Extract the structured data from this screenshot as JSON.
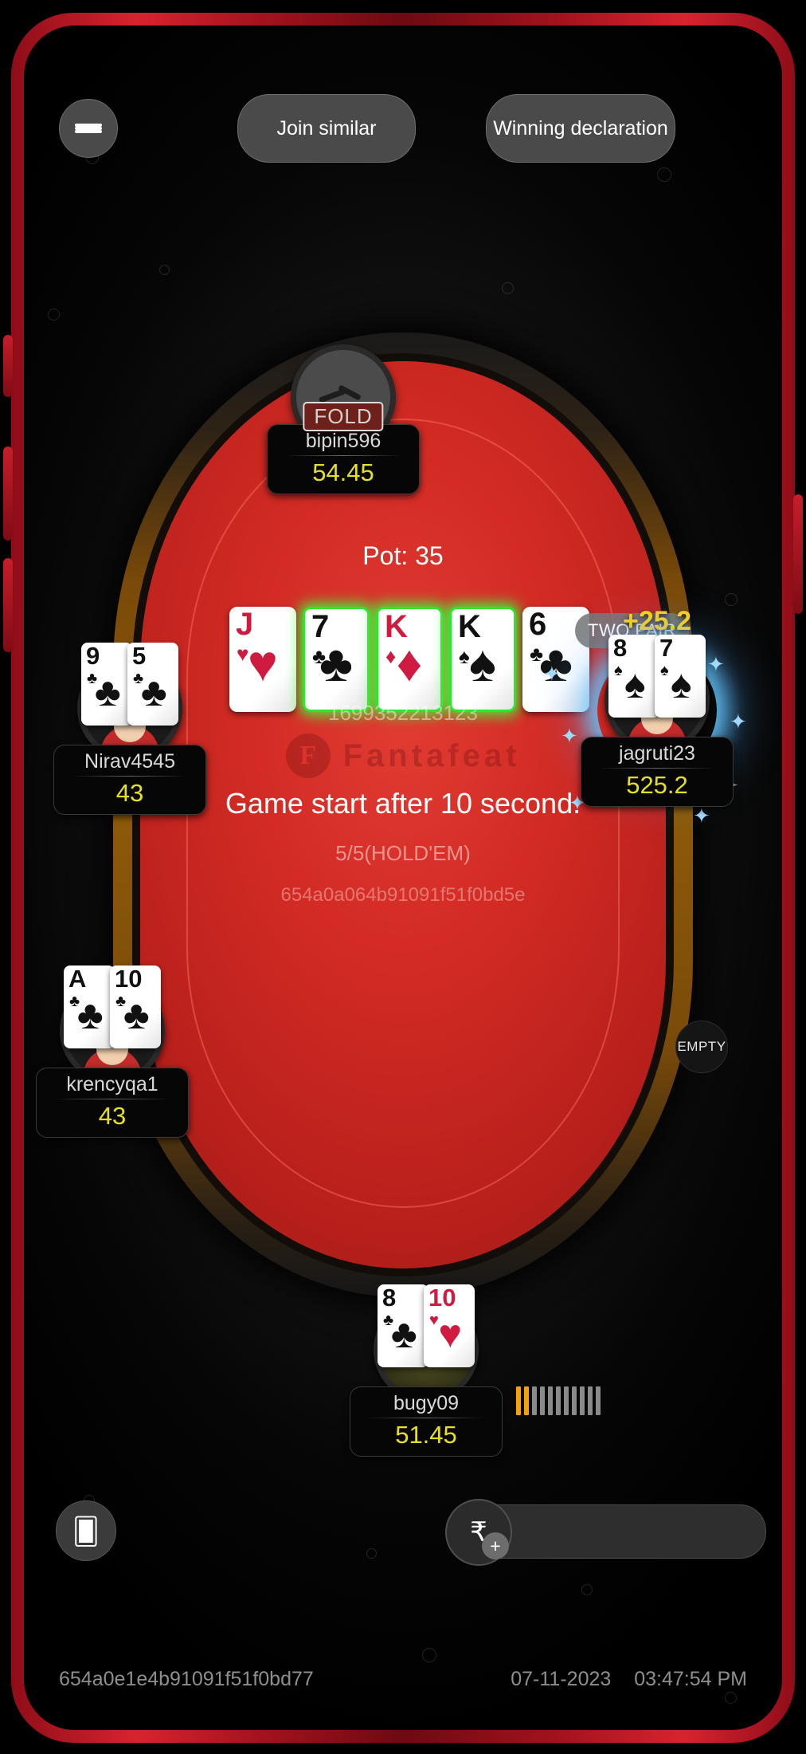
{
  "topbar": {
    "menu_icon": "hamburger-icon",
    "join_similar_label": "Join similar",
    "winning_declaration_label": "Winning declaration"
  },
  "table": {
    "pot_label": "Pot: 35",
    "hand_id": "1699352213123",
    "game_status": "Game start after 10 second.",
    "blinds": "5/5(HOLD'EM)",
    "table_id": "654a0a064b91091f51f0bd5e",
    "logo_word": "Fantafeat",
    "logo_mark": "F",
    "hand_rank_badge": "TWO PAIR",
    "empty_seat_label": "EMPTY"
  },
  "community_cards": [
    {
      "rank": "J",
      "suit": "♥",
      "color": "red",
      "highlight": false
    },
    {
      "rank": "7",
      "suit": "♣",
      "color": "black",
      "highlight": true
    },
    {
      "rank": "K",
      "suit": "♦",
      "color": "red",
      "highlight": true
    },
    {
      "rank": "K",
      "suit": "♠",
      "color": "black",
      "highlight": true
    },
    {
      "rank": "6",
      "suit": "♣",
      "color": "black",
      "highlight": false
    }
  ],
  "players": {
    "bipin596": {
      "name": "bipin596",
      "chips": "54.45",
      "status": "FOLD"
    },
    "nirav4545": {
      "name": "Nirav4545",
      "chips": "43",
      "cards": [
        {
          "rank": "9",
          "suit": "♣",
          "color": "black"
        },
        {
          "rank": "5",
          "suit": "♣",
          "color": "black"
        }
      ]
    },
    "jagruti23": {
      "name": "jagruti23",
      "chips": "525.2",
      "win_amount": "+25.2",
      "cards": [
        {
          "rank": "8",
          "suit": "♠",
          "color": "black"
        },
        {
          "rank": "7",
          "suit": "♠",
          "color": "black"
        }
      ]
    },
    "krencyqa1": {
      "name": "krencyqa1",
      "chips": "43",
      "cards": [
        {
          "rank": "A",
          "suit": "♣",
          "color": "black"
        },
        {
          "rank": "10",
          "suit": "♣",
          "color": "black"
        }
      ]
    },
    "bugy09": {
      "name": "bugy09",
      "chips": "51.45",
      "cards": [
        {
          "rank": "8",
          "suit": "♣",
          "color": "black"
        },
        {
          "rank": "10",
          "suit": "♥",
          "color": "red"
        }
      ],
      "timer_bars_total": 11,
      "timer_bars_active": 2
    }
  },
  "controls": {
    "cards_icon": "cards-icon",
    "chip_icon": "₹",
    "chip_plus": "+"
  },
  "footer": {
    "session_id": "654a0e1e4b91091f51f0bd77",
    "date": "07-11-2023",
    "time": "03:47:54 PM"
  },
  "colors": {
    "frame": "#d8232f",
    "felt": "#d32b24",
    "rail": "#8d5a0a",
    "chips": "#e6e11f",
    "win": "#ffd21a",
    "highlight": "#2ce82c"
  }
}
